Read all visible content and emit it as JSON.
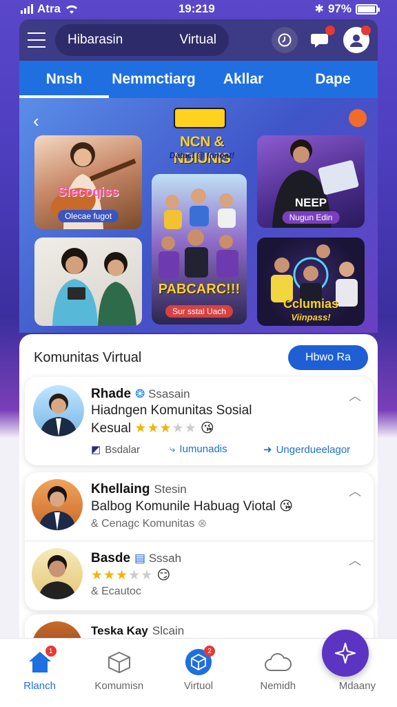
{
  "status": {
    "carrier": "Atra",
    "time": "19:219",
    "battery": "97%",
    "battery_level": 0.97
  },
  "header": {
    "search_left": "Hibarasin",
    "search_right": "Virtual"
  },
  "tabs": [
    {
      "label": "Nnsh",
      "active": true
    },
    {
      "label": "Nemmctiarg",
      "active": false
    },
    {
      "label": "Akllar",
      "active": false
    },
    {
      "label": "Dape",
      "active": false
    }
  ],
  "banner": {
    "title": "NCN & NDIUNIS",
    "subtitle": "Datacl @ Innoat!",
    "cards": [
      {
        "title": "Slecoqiss",
        "caption": "Olecae fugot"
      },
      {
        "title": "NEEP",
        "caption": "Nugun Edin"
      },
      {
        "title": "PABCARC!!!",
        "caption": "Sur sstal Uach"
      },
      {
        "title": "Cclumias",
        "caption": "Viinpass!"
      }
    ]
  },
  "sheet": {
    "title": "Komunitas Virtual",
    "button": "Hbwo Ra"
  },
  "posts": [
    {
      "name": "Rhade",
      "tag": "Ssasain",
      "text": "Hiadngen Komunitas Sosial",
      "meta_prefix": "Kesual",
      "stars": 3,
      "actions": [
        "Bsdalar",
        "Iumunadis",
        "Ungerdueelagor"
      ]
    },
    {
      "name": "Khellaing",
      "tag": "Stesin",
      "text": "Balbog Komunile Habuag Viotal",
      "meta": "& Cenagc Komunitas"
    },
    {
      "name": "Basde",
      "tag": "Sssah",
      "stars": 3,
      "meta": "& Ecautoc"
    },
    {
      "name": "Teska Kay",
      "tag": "Slcain"
    }
  ],
  "nav": [
    {
      "label": "Rlanch",
      "badge": "1",
      "active": true
    },
    {
      "label": "Komumisn",
      "badge": ""
    },
    {
      "label": "Virtuol",
      "badge": "2"
    },
    {
      "label": "Nemidh",
      "badge": ""
    },
    {
      "label": "Mdaany",
      "badge": ""
    }
  ],
  "colors": {
    "accent": "#1f6fe0",
    "fab": "#5b34c4",
    "star": "#f5b400",
    "badge": "#e53935"
  }
}
